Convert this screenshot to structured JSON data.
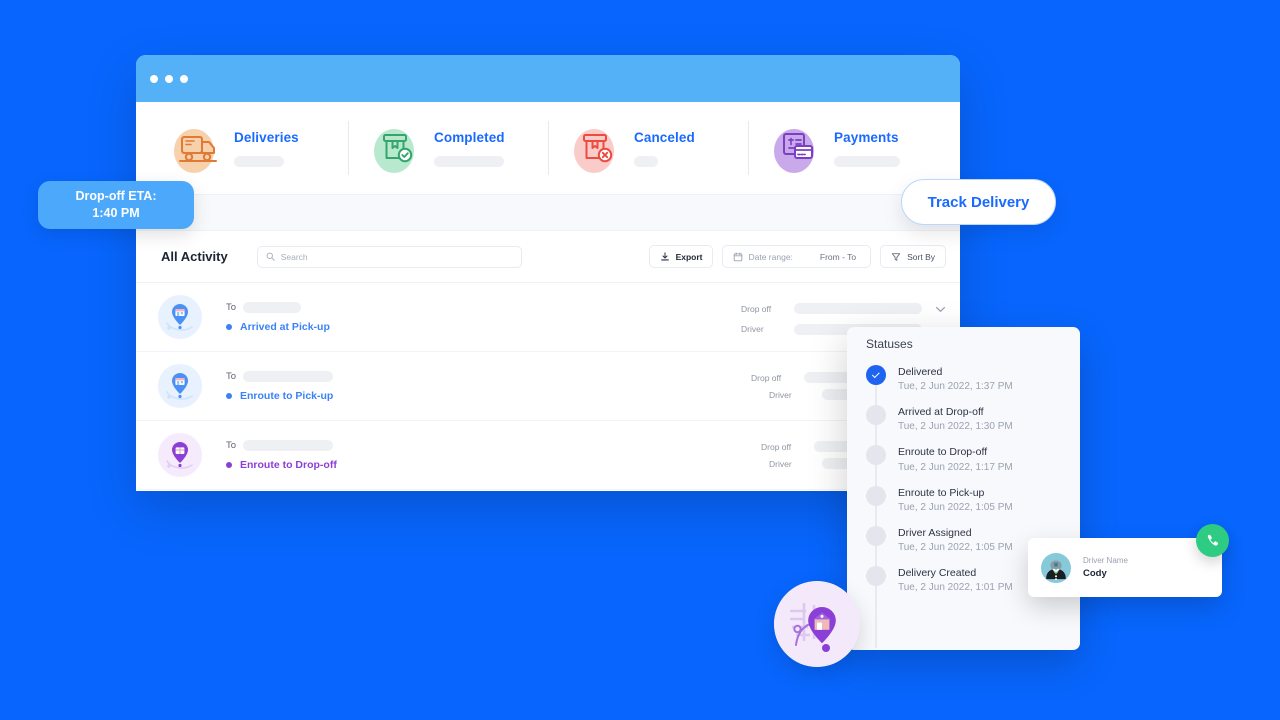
{
  "theme": {
    "background": "#0866fe",
    "titlebar": "#54b0f7",
    "accent_blue": "#1a6aff",
    "status_done": "#1f64f0",
    "call_green": "#2ecc82",
    "purple": "#7b3fc4"
  },
  "window": {
    "nav": [
      {
        "label": "Deliveries",
        "icon": "truck-icon",
        "blob": "#f6d1ab"
      },
      {
        "label": "Completed",
        "icon": "box-check-icon",
        "blob": "#b8e8ce"
      },
      {
        "label": "Canceled",
        "icon": "box-cancel-icon",
        "blob": "#f9ccc9"
      },
      {
        "label": "Payments",
        "icon": "invoice-card-icon",
        "blob": "#c9a9ea"
      }
    ],
    "toolbar": {
      "title": "All Activity",
      "search_placeholder": "Search",
      "export_label": "Export",
      "daterange_label": "Date range:",
      "daterange_value": "From - To",
      "sortby_label": "Sort By"
    },
    "rows": [
      {
        "to_label": "To",
        "status": "Arrived at Pick-up",
        "status_color": "#3b82f6",
        "icon": "pickup-pin-icon",
        "dropoff_label": "Drop off",
        "driver_label": "Driver"
      },
      {
        "to_label": "To",
        "status": "Enroute to Pick-up",
        "status_color": "#3b82f6",
        "icon": "pickup-pin-icon",
        "dropoff_label": "Drop off",
        "driver_label": "Driver"
      },
      {
        "to_label": "To",
        "status": "Enroute to Drop-off",
        "status_color": "#8b3fd6",
        "icon": "dropoff-pin-icon",
        "dropoff_label": "Drop off",
        "driver_label": "Driver"
      }
    ]
  },
  "eta_pill": {
    "line1": "Drop-off ETA:",
    "line2": "1:40 PM"
  },
  "track_pill": {
    "label": "Track Delivery"
  },
  "statuses": {
    "title": "Statuses",
    "items": [
      {
        "name": "Delivered",
        "time": "Tue, 2 Jun 2022, 1:37 PM",
        "done": true
      },
      {
        "name": "Arrived at Drop-off",
        "time": "Tue, 2 Jun 2022, 1:30 PM",
        "done": false
      },
      {
        "name": "Enroute to Drop-off",
        "time": "Tue, 2 Jun 2022, 1:17 PM",
        "done": false
      },
      {
        "name": "Enroute to Pick-up",
        "time": "Tue, 2 Jun 2022, 1:05 PM",
        "done": false
      },
      {
        "name": "Driver Assigned",
        "time": "Tue, 2 Jun 2022, 1:05 PM",
        "done": false
      },
      {
        "name": "Delivery Created",
        "time": "Tue, 2 Jun 2022, 1:01 PM",
        "done": false
      }
    ]
  },
  "driver_card": {
    "label": "Driver Name",
    "name": "Cody",
    "avatar_icon": "driver-avatar-icon",
    "call_icon": "phone-icon"
  },
  "map_badge": {
    "icon": "map-pin-house-icon"
  }
}
